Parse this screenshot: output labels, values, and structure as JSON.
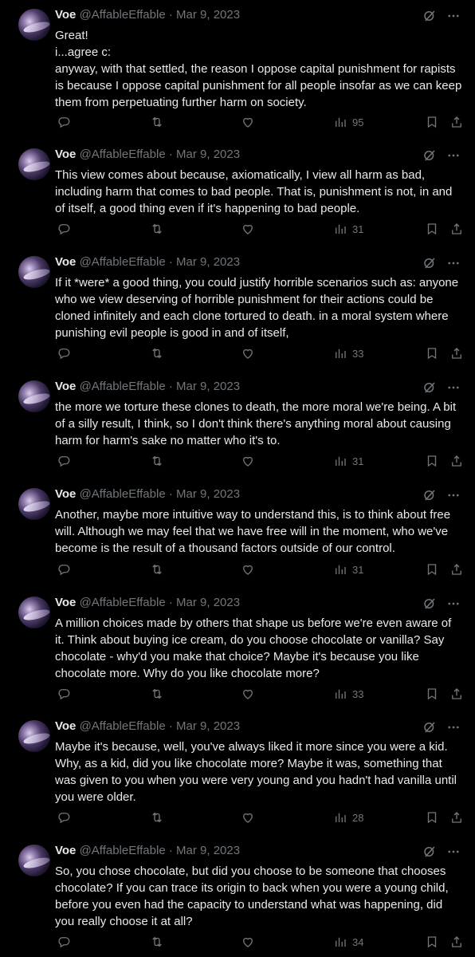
{
  "user": {
    "name": "Voe",
    "handle": "@AffableEffable",
    "separator": "·"
  },
  "colors": {
    "background": "#000000",
    "text": "#e7e9ea",
    "muted": "#71767b"
  },
  "tweets": [
    {
      "date": "Mar 9, 2023",
      "text": "Great!\ni...agree c:\nanyway, with that settled, the reason I oppose capital punishment for rapists is because I oppose capital punishment for all people insofar as we can keep them from perpetuating further harm on society.",
      "views": "95"
    },
    {
      "date": "Mar 9, 2023",
      "text": "This view comes about because, axiomatically, I view all harm as bad, including harm that comes to bad people. That is, punishment is not, in and of itself, a good thing even if it's happening to bad people.",
      "views": "31"
    },
    {
      "date": "Mar 9, 2023",
      "text": "If it *were* a good thing, you could justify horrible scenarios such as: anyone who we view deserving of horrible punishment for their actions could be cloned infinitely and each clone tortured to death. in a moral system where punishing evil people is good in and of itself,",
      "views": "33"
    },
    {
      "date": "Mar 9, 2023",
      "text": "the more we torture these clones to death, the more moral we're being. A bit of a silly result, I think, so I don't think there's anything moral about causing harm for harm's sake no matter who it's to.",
      "views": "31"
    },
    {
      "date": "Mar 9, 2023",
      "text": "Another, maybe more intuitive way to understand this, is to think about free will. Although we may feel that we have free will in the moment, who we've become is the result of a thousand factors outside of our control.",
      "views": "31"
    },
    {
      "date": "Mar 9, 2023",
      "text": "A million choices made by others that shape us before we're even aware of it. Think about buying ice cream, do you choose chocolate or vanilla? Say chocolate - why'd you make that choice? Maybe it's because you like chocolate more. Why do you like chocolate more?",
      "views": "33"
    },
    {
      "date": "Mar 9, 2023",
      "text": "Maybe it's because, well, you've always liked it more since you were a kid. Why, as a kid, did you like chocolate more? Maybe it was, something that was given to you when you were very young and you hadn't had vanilla until you were older.",
      "views": "28"
    },
    {
      "date": "Mar 9, 2023",
      "text": "So, you chose chocolate, but did you choose to be someone that chooses chocolate? If you can trace its origin to back when you were a young child, before you even had the capacity to understand what was happening, did you really choose it at all?",
      "views": "34"
    }
  ]
}
